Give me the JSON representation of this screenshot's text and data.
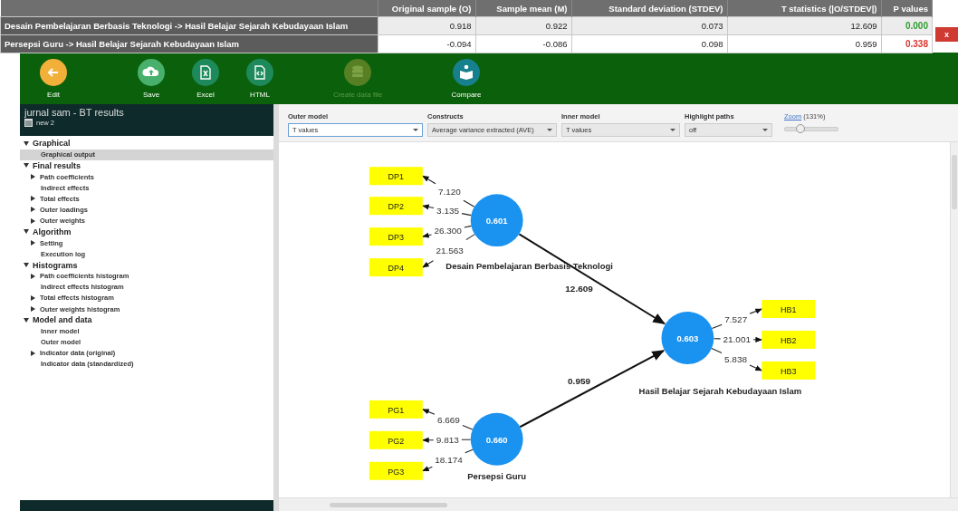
{
  "results_table": {
    "columns": [
      "",
      "Original sample (O)",
      "Sample mean (M)",
      "Standard deviation (STDEV)",
      "T statistics (|O/STDEV|)",
      "P values"
    ],
    "rows": [
      {
        "cells": [
          "Desain Pembelajaran Berbasis Teknologi -> Hasil Belajar Sejarah Kebudayaan Islam",
          "0.918",
          "0.922",
          "0.073",
          "12.609",
          "0.000"
        ],
        "color": "#2e9e2e"
      },
      {
        "cells": [
          "Persepsi Guru -> Hasil Belajar Sejarah Kebudayaan Islam",
          "-0.094",
          "-0.086",
          "0.098",
          "0.959",
          "0.338"
        ],
        "color": "#d9362f"
      }
    ],
    "close_button": "x"
  },
  "toolbar": [
    {
      "label": "Edit",
      "disabled": false
    },
    {
      "label": "Save",
      "disabled": false
    },
    {
      "label": "Excel",
      "disabled": false
    },
    {
      "label": "HTML",
      "disabled": false
    },
    {
      "label": "Create data file",
      "disabled": true
    },
    {
      "label": "Compare",
      "disabled": false
    }
  ],
  "sidebar": {
    "title": "jurnal sam - BT results",
    "project": "new 2",
    "tree": [
      {
        "label": "Graphical",
        "expanded": true,
        "children": [
          {
            "label": "Graphical output",
            "selected": true
          }
        ]
      },
      {
        "label": "Final results",
        "expanded": true,
        "children": [
          {
            "label": "Path coefficients",
            "expanded": false,
            "selected": false
          },
          {
            "label": "Indirect effects",
            "selected": false
          },
          {
            "label": "Total effects",
            "expanded": false,
            "selected": false
          },
          {
            "label": "Outer loadings",
            "expanded": false,
            "selected": false
          },
          {
            "label": "Outer weights",
            "expanded": false,
            "selected": false
          }
        ]
      },
      {
        "label": "Algorithm",
        "expanded": true,
        "children": [
          {
            "label": "Setting",
            "expanded": false,
            "selected": false
          },
          {
            "label": "Execution log",
            "selected": false
          }
        ]
      },
      {
        "label": "Histograms",
        "expanded": true,
        "children": [
          {
            "label": "Path coefficients histogram",
            "expanded": false,
            "selected": false
          },
          {
            "label": "Indirect effects histogram",
            "selected": false
          },
          {
            "label": "Total effects histogram",
            "expanded": false,
            "selected": false
          },
          {
            "label": "Outer weights histogram",
            "expanded": false,
            "selected": false
          }
        ]
      },
      {
        "label": "Model and data",
        "expanded": true,
        "children": [
          {
            "label": "Inner model",
            "selected": false
          },
          {
            "label": "Outer model",
            "selected": false
          },
          {
            "label": "Indicator data (original)",
            "expanded": false,
            "selected": false
          },
          {
            "label": "Indicator data (standardized)",
            "selected": false
          }
        ]
      }
    ]
  },
  "controls": {
    "dropdowns": [
      {
        "label": "Outer model",
        "value": "T values"
      },
      {
        "label": "Constructs",
        "value": "Average variance extracted (AVE)"
      },
      {
        "label": "Inner model",
        "value": "T values"
      },
      {
        "label": "Highlight paths",
        "value": "off"
      }
    ],
    "zoom": {
      "link": "Zoom",
      "value": "(131%)",
      "level": 0.3
    }
  },
  "diagram": {
    "constructs": [
      {
        "name": "Desain Pembelajaran Berbasis Teknologi",
        "value": "0.601",
        "indicators": [
          {
            "name": "DP1",
            "weight": "7.120"
          },
          {
            "name": "DP2",
            "weight": "3.135"
          },
          {
            "name": "DP3",
            "weight": "26.300"
          },
          {
            "name": "DP4",
            "weight": "21.563"
          }
        ]
      },
      {
        "name": "Hasil Belajar Sejarah Kebudayaan Islam",
        "value": "0.603",
        "indicators": [
          {
            "name": "HB1",
            "weight": "7.527"
          },
          {
            "name": "HB2",
            "weight": "21.001"
          },
          {
            "name": "HB3",
            "weight": "5.838"
          }
        ]
      },
      {
        "name": "Persepsi Guru",
        "value": "0.660",
        "indicators": [
          {
            "name": "PG1",
            "weight": "6.669"
          },
          {
            "name": "PG2",
            "weight": "9.813"
          },
          {
            "name": "PG3",
            "weight": "18.174"
          }
        ]
      }
    ],
    "paths": [
      {
        "value": "12.609"
      },
      {
        "value": "0.959"
      }
    ]
  }
}
